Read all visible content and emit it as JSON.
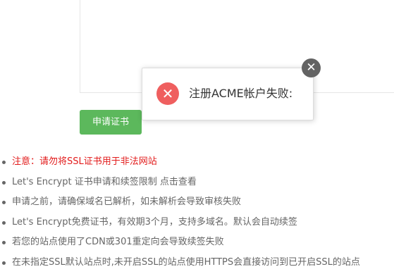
{
  "form": {
    "apply_button_label": "申请证书"
  },
  "notes": [
    {
      "text": "注意：请勿将SSL证书用于非法网站",
      "warning": true
    },
    {
      "text": "Let's Encrypt 证书申请和续签限制 点击查看",
      "warning": false
    },
    {
      "text": "申请之前，请确保域名已解析，如未解析会导致审核失败",
      "warning": false
    },
    {
      "text": "Let's Encrypt免费证书，有效期3个月，支持多域名。默认会自动续签",
      "warning": false
    },
    {
      "text": "若您的站点使用了CDN或301重定向会导致续签失败",
      "warning": false
    },
    {
      "text": "在未指定SSL默认站点时,未开启SSL的站点使用HTTPS会直接访问到已开启SSL的站点",
      "warning": false
    }
  ],
  "toast": {
    "message": "注册ACME帐户失败:",
    "icon": "error-x-icon",
    "close_icon": "close-icon",
    "error_color": "#ef5f5f"
  },
  "colors": {
    "button": "#5cb85c",
    "warning_text": "#e21b1b"
  }
}
